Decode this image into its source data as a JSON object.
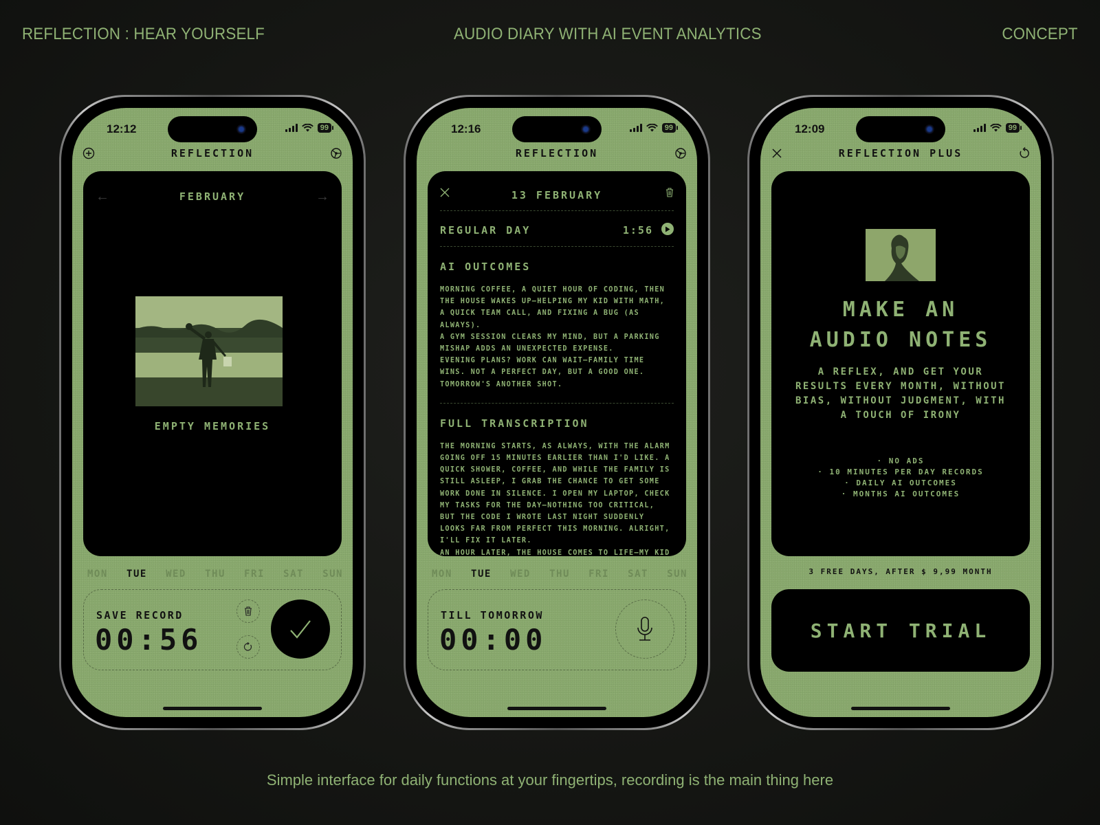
{
  "header": {
    "left": "REFLECTION : HEAR YOURSELF",
    "center": "AUDIO DIARY WITH AI EVENT ANALYTICS",
    "right": "CONCEPT"
  },
  "caption": "Simple interface for daily functions at your fingertips, recording is the main thing here",
  "colors": {
    "screen_green": "#8aaa6e",
    "text_green": "#8fb274",
    "ink": "#111111",
    "card_black": "#000000"
  },
  "days": [
    "MON",
    "TUE",
    "WED",
    "THU",
    "FRI",
    "SAT",
    "SUN"
  ],
  "active_day": "TUE",
  "phones": [
    {
      "status": {
        "time": "12:12",
        "battery": "99"
      },
      "nav": {
        "title": "REFLECTION",
        "left_icon": "plus-circle-icon",
        "right_icon": "settings-icon"
      },
      "calendar": {
        "month": "FEBRUARY",
        "prev_icon": "arrow-left-icon",
        "next_icon": "arrow-right-icon"
      },
      "empty_label": "EMPTY MEMORIES",
      "recorder": {
        "label": "SAVE RECORD",
        "time": "00:56",
        "delete_icon": "trash-icon",
        "redo_icon": "refresh-icon",
        "confirm_icon": "check-icon"
      }
    },
    {
      "status": {
        "time": "12:16",
        "battery": "99"
      },
      "nav": {
        "title": "REFLECTION",
        "left_icon": "none",
        "right_icon": "settings-icon"
      },
      "entry": {
        "date": "13 FEBRUARY",
        "record_title": "REGULAR DAY",
        "duration": "1:56",
        "ai_title": "AI OUTCOMES",
        "ai_text": "MORNING COFFEE, A QUIET HOUR OF CODING, THEN THE HOUSE WAKES UP—HELPING MY KID WITH MATH, A QUICK TEAM CALL, AND FIXING A BUG (AS ALWAYS).\nA GYM SESSION CLEARS MY MIND, BUT A PARKING MISHAP ADDS AN UNEXPECTED EXPENSE.\nEVENING PLANS? WORK CAN WAIT—FAMILY TIME WINS. NOT A PERFECT DAY, BUT A GOOD ONE. TOMORROW'S ANOTHER SHOT.",
        "transcription_title": "FULL TRANSCRIPTION",
        "transcription_text": "THE MORNING STARTS, AS ALWAYS, WITH THE ALARM GOING OFF 15 MINUTES EARLIER THAN I'D LIKE. A QUICK SHOWER, COFFEE, AND WHILE THE FAMILY IS STILL ASLEEP, I GRAB THE CHANCE TO GET SOME WORK DONE IN SILENCE. I OPEN MY LAPTOP, CHECK MY TASKS FOR THE DAY—NOTHING TOO CRITICAL, BUT THE CODE I WROTE LAST NIGHT SUDDENLY LOOKS FAR FROM PERFECT THIS MORNING. ALRIGHT, I'LL FIX IT LATER.\nAN HOUR LATER, THE HOUSE COMES TO LIFE—MY KID IS GETTING READY FOR WORK AND WE IS"
      },
      "recorder": {
        "label": "TILL TOMORROW",
        "time": "00:00",
        "mic_icon": "microphone-icon"
      }
    },
    {
      "status": {
        "time": "12:09",
        "battery": "99"
      },
      "nav": {
        "title": "REFLECTION PLUS",
        "left_icon": "close-icon",
        "right_icon": "restore-icon"
      },
      "paywall": {
        "headline_1": "MAKE AN",
        "headline_2": "AUDIO NOTES",
        "subtext": "A REFLEX, AND GET YOUR RESULTS EVERY MONTH, WITHOUT BIAS, WITHOUT JUDGMENT, WITH A TOUCH OF IRONY",
        "features": [
          "· NO ADS",
          "· 10 MINUTES PER DAY RECORDS",
          "· DAILY AI OUTCOMES",
          "· MONTHS AI OUTCOMES"
        ],
        "price_note": "3 FREE DAYS, AFTER $ 9,99 MONTH",
        "cta": "START TRIAL"
      }
    }
  ]
}
